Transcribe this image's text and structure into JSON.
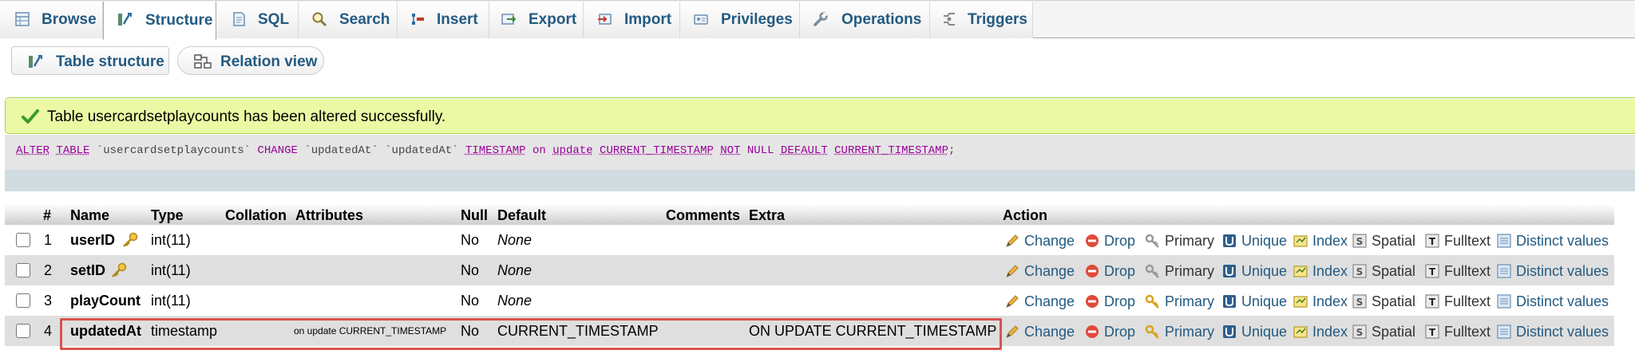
{
  "tabs": [
    {
      "id": "browse",
      "label": "Browse",
      "icon": "browse-icon",
      "active": false
    },
    {
      "id": "structure",
      "label": "Structure",
      "icon": "structure-icon",
      "active": true
    },
    {
      "id": "sql",
      "label": "SQL",
      "icon": "sql-icon",
      "active": false
    },
    {
      "id": "search",
      "label": "Search",
      "icon": "search-icon",
      "active": false
    },
    {
      "id": "insert",
      "label": "Insert",
      "icon": "insert-icon",
      "active": false
    },
    {
      "id": "export",
      "label": "Export",
      "icon": "export-icon",
      "active": false
    },
    {
      "id": "import",
      "label": "Import",
      "icon": "import-icon",
      "active": false
    },
    {
      "id": "privileges",
      "label": "Privileges",
      "icon": "privileges-icon",
      "active": false
    },
    {
      "id": "operations",
      "label": "Operations",
      "icon": "wrench-icon",
      "active": false
    },
    {
      "id": "triggers",
      "label": "Triggers",
      "icon": "triggers-icon",
      "active": false
    }
  ],
  "subtabs": {
    "table_structure": "Table structure",
    "relation_view": "Relation view"
  },
  "message": {
    "text": "Table usercardsetplaycounts has been altered successfully.",
    "sql": {
      "alter": "ALTER",
      "table": "TABLE",
      "tbl": "`usercardsetplaycounts`",
      "change": "CHANGE",
      "col1": "`updatedAt`",
      "col2": "`updatedAt`",
      "type": "TIMESTAMP",
      "on": "on",
      "update": "update",
      "ct1": "CURRENT_TIMESTAMP",
      "not": "NOT",
      "null": "NULL",
      "default": "DEFAULT",
      "ct2": "CURRENT_TIMESTAMP",
      "end": ";"
    }
  },
  "headers": {
    "num": "#",
    "name": "Name",
    "type": "Type",
    "collation": "Collation",
    "attributes": "Attributes",
    "null": "Null",
    "default": "Default",
    "comments": "Comments",
    "extra": "Extra",
    "action": "Action"
  },
  "rows": [
    {
      "num": "1",
      "name": "userID",
      "key": "primary",
      "type": "int(11)",
      "collation": "",
      "attributes": "",
      "null": "No",
      "default": "None",
      "comments": "",
      "extra": ""
    },
    {
      "num": "2",
      "name": "setID",
      "key": "primary",
      "type": "int(11)",
      "collation": "",
      "attributes": "",
      "null": "No",
      "default": "None",
      "comments": "",
      "extra": ""
    },
    {
      "num": "3",
      "name": "playCount",
      "key": "",
      "type": "int(11)",
      "collation": "",
      "attributes": "",
      "null": "No",
      "default": "None",
      "comments": "",
      "extra": ""
    },
    {
      "num": "4",
      "name": "updatedAt",
      "key": "",
      "type": "timestamp",
      "collation": "",
      "attributes": "on update CURRENT_TIMESTAMP",
      "null": "No",
      "default": "CURRENT_TIMESTAMP",
      "comments": "",
      "extra": "ON UPDATE CURRENT_TIMESTAMP"
    }
  ],
  "actions": {
    "change": "Change",
    "drop": "Drop",
    "primary": "Primary",
    "unique": "Unique",
    "index": "Index",
    "spatial": "Spatial",
    "fulltext": "Fulltext",
    "distinct": "Distinct values"
  },
  "colors": {
    "link": "#235a81",
    "success_bg": "#ebf8a4",
    "success_border": "#a2d246",
    "highlight": "#d9534f",
    "sql_keyword": "#990099"
  }
}
